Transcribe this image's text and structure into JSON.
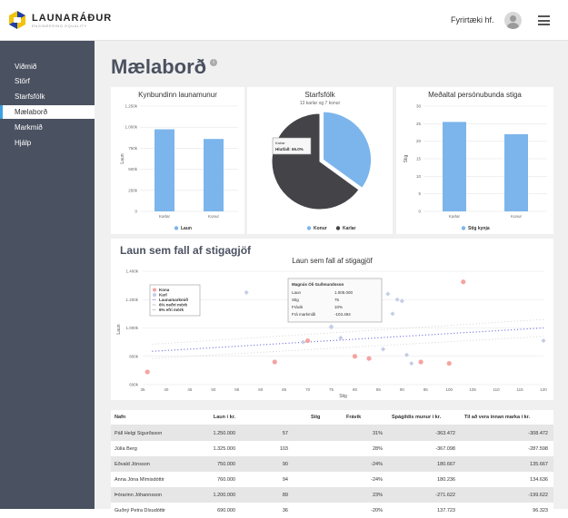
{
  "brand": {
    "name": "LAUNARÁÐUR",
    "tagline": "ENGINEERING EQUALITY"
  },
  "header": {
    "company": "Fyrirtæki hf."
  },
  "sidebar": {
    "items": [
      {
        "label": "Viðmið"
      },
      {
        "label": "Störf"
      },
      {
        "label": "Starfsfólk"
      },
      {
        "label": "Mælaborð"
      },
      {
        "label": "Markmið"
      },
      {
        "label": "Hjálp"
      }
    ]
  },
  "page": {
    "title": "Mælaborð",
    "info": "i"
  },
  "card1": {
    "title": "Kynbundinn launamunur",
    "ylabel": "Laun",
    "legend": "Laun"
  },
  "card2": {
    "title": "Starfsfólk",
    "subtitle": "13 karlar og 7 konur",
    "legend_a": "Konur",
    "legend_b": "Karlar",
    "tooltip_name": "Karlar",
    "tooltip_value": "Hlutfall: 65.0%"
  },
  "card3": {
    "title": "Meðaltal persónubunda stiga",
    "ylabel": "Stig",
    "legend": "Stig kynja"
  },
  "card4": {
    "heading": "Laun sem fall af stigagjöf",
    "title": "Laun sem fall af stigagjöf",
    "xlabel": "Stig",
    "ylabel": "Laun",
    "legend": [
      "Kona",
      "Karl",
      "Launamarkmið",
      "6% neðri mörk",
      "6% efri mörk"
    ],
    "tooltip": {
      "name": "Magnús Óli Guðmundsson",
      "rows": [
        {
          "k": "Laun",
          "v": "1.005.000"
        },
        {
          "k": "Stig",
          "v": "75"
        },
        {
          "k": "Frávik",
          "v": "10%"
        },
        {
          "k": "Frá markmiði",
          "v": "-103.494"
        }
      ]
    }
  },
  "table": {
    "headers": [
      "Nafn",
      "Laun í kr.",
      "Stig",
      "Frávik",
      "Spágildis munur í kr.",
      "Til að vera innan marka í kr."
    ],
    "rows": [
      [
        "Páll Helgi Sigurðsson",
        "1.250.000",
        "57",
        "31%",
        "-363.472",
        "-308.472"
      ],
      [
        "Júlía Berg",
        "1.325.000",
        "103",
        "28%",
        "-367.098",
        "-287.598"
      ],
      [
        "Eðvald Jónsson",
        "750.000",
        "90",
        "-24%",
        "180.667",
        "135.667"
      ],
      [
        "Anna Jóna Mímisdóttir",
        "760.000",
        "94",
        "-24%",
        "180.236",
        "134.636"
      ],
      [
        "Þórarinn Jóhannsson",
        "1.200.000",
        "89",
        "23%",
        "-271.622",
        "-199.622"
      ],
      [
        "Guðný Petra Dísudóttir",
        "690.000",
        "36",
        "-20%",
        "137.723",
        "96.323"
      ]
    ]
  },
  "colors": {
    "accent": "#3aa0e0",
    "sidebar": "#4a5160",
    "bar": "#7cb5ec",
    "dark": "#434348",
    "women": "#f7a35c",
    "point_women": "#f4a4a0",
    "point_men": "#c5cce6",
    "target": "#6b6bdc"
  },
  "chart_data": [
    {
      "type": "bar",
      "title": "Kynbundinn launamunur",
      "categories": [
        "Karlar",
        "Konur"
      ],
      "series": [
        {
          "name": "Laun",
          "values": [
            975000,
            860000
          ]
        }
      ],
      "ylabel": "Laun",
      "ylim": [
        0,
        1250000
      ],
      "yticks": [
        "0",
        "250k",
        "500k",
        "750k",
        "1.000k",
        "1.250k"
      ]
    },
    {
      "type": "pie",
      "title": "Starfsfólk",
      "subtitle": "13 karlar og 7 konur",
      "labels": [
        "Konur",
        "Karlar"
      ],
      "values": [
        35,
        65
      ]
    },
    {
      "type": "bar",
      "title": "Meðaltal persónubunda stiga",
      "categories": [
        "Karlar",
        "Konur"
      ],
      "series": [
        {
          "name": "Stig kynja",
          "values": [
            25.5,
            22
          ]
        }
      ],
      "ylabel": "Stig",
      "ylim": [
        0,
        30
      ],
      "yticks": [
        "0",
        "5",
        "10",
        "15",
        "20",
        "25",
        "30"
      ]
    },
    {
      "type": "scatter",
      "title": "Laun sem fall af stigagjöf",
      "xlabel": "Stig",
      "ylabel": "Laun",
      "xlim": [
        35,
        120
      ],
      "ylim": [
        600000,
        1400000
      ],
      "xticks": [
        "35",
        "40",
        "45",
        "50",
        "55",
        "60",
        "65",
        "70",
        "75",
        "80",
        "85",
        "90",
        "95",
        "100",
        "105",
        "110",
        "115",
        "120"
      ],
      "yticks": [
        "600k",
        "800k",
        "1.000k",
        "1.200k",
        "1.400k"
      ],
      "series": [
        {
          "name": "Kona",
          "points": [
            [
              36,
              690000
            ],
            [
              63,
              760000
            ],
            [
              70,
              910000
            ],
            [
              80,
              800000
            ],
            [
              83,
              785000
            ],
            [
              94,
              760000
            ],
            [
              100,
              750000
            ],
            [
              103,
              1325000
            ]
          ]
        },
        {
          "name": "Karl",
          "points": [
            [
              57,
              1250000
            ],
            [
              69,
              900000
            ],
            [
              75,
              1005000
            ],
            [
              75,
              1010000
            ],
            [
              77,
              930000
            ],
            [
              86,
              850000
            ],
            [
              87,
              1240000
            ],
            [
              88,
              1100000
            ],
            [
              89,
              1200000
            ],
            [
              90,
              1190000
            ],
            [
              91,
              810000
            ],
            [
              92,
              750000
            ],
            [
              120,
              910000
            ]
          ]
        },
        {
          "name": "Launamarkmið",
          "points": [
            [
              37,
              835000
            ],
            [
              120,
              1000000
            ]
          ]
        },
        {
          "name": "6% neðri mörk",
          "points": [
            [
              37,
              785000
            ],
            [
              120,
              940000
            ]
          ]
        },
        {
          "name": "6% efri mörk",
          "points": [
            [
              37,
              885000
            ],
            [
              120,
              1060000
            ]
          ]
        }
      ]
    }
  ]
}
